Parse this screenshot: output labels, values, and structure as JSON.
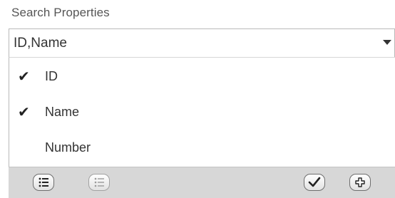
{
  "search_properties": {
    "label": "Search Properties",
    "selected_value": "ID,Name",
    "dropdown_icon": "chevron-down-icon"
  },
  "options": [
    {
      "label": "ID",
      "checked": true
    },
    {
      "label": "Name",
      "checked": true
    },
    {
      "label": "Number",
      "checked": false
    }
  ],
  "footer": {
    "buttons": [
      {
        "icon": "select-all-list-icon",
        "enabled": true
      },
      {
        "icon": "deselect-all-list-icon",
        "enabled": false
      },
      {
        "icon": "checkmark-icon",
        "enabled": true
      },
      {
        "icon": "plus-icon",
        "enabled": true
      }
    ]
  },
  "colors": {
    "footer_bg": "#d7d7d7",
    "border": "#b9b9b9",
    "text": "#333333"
  }
}
